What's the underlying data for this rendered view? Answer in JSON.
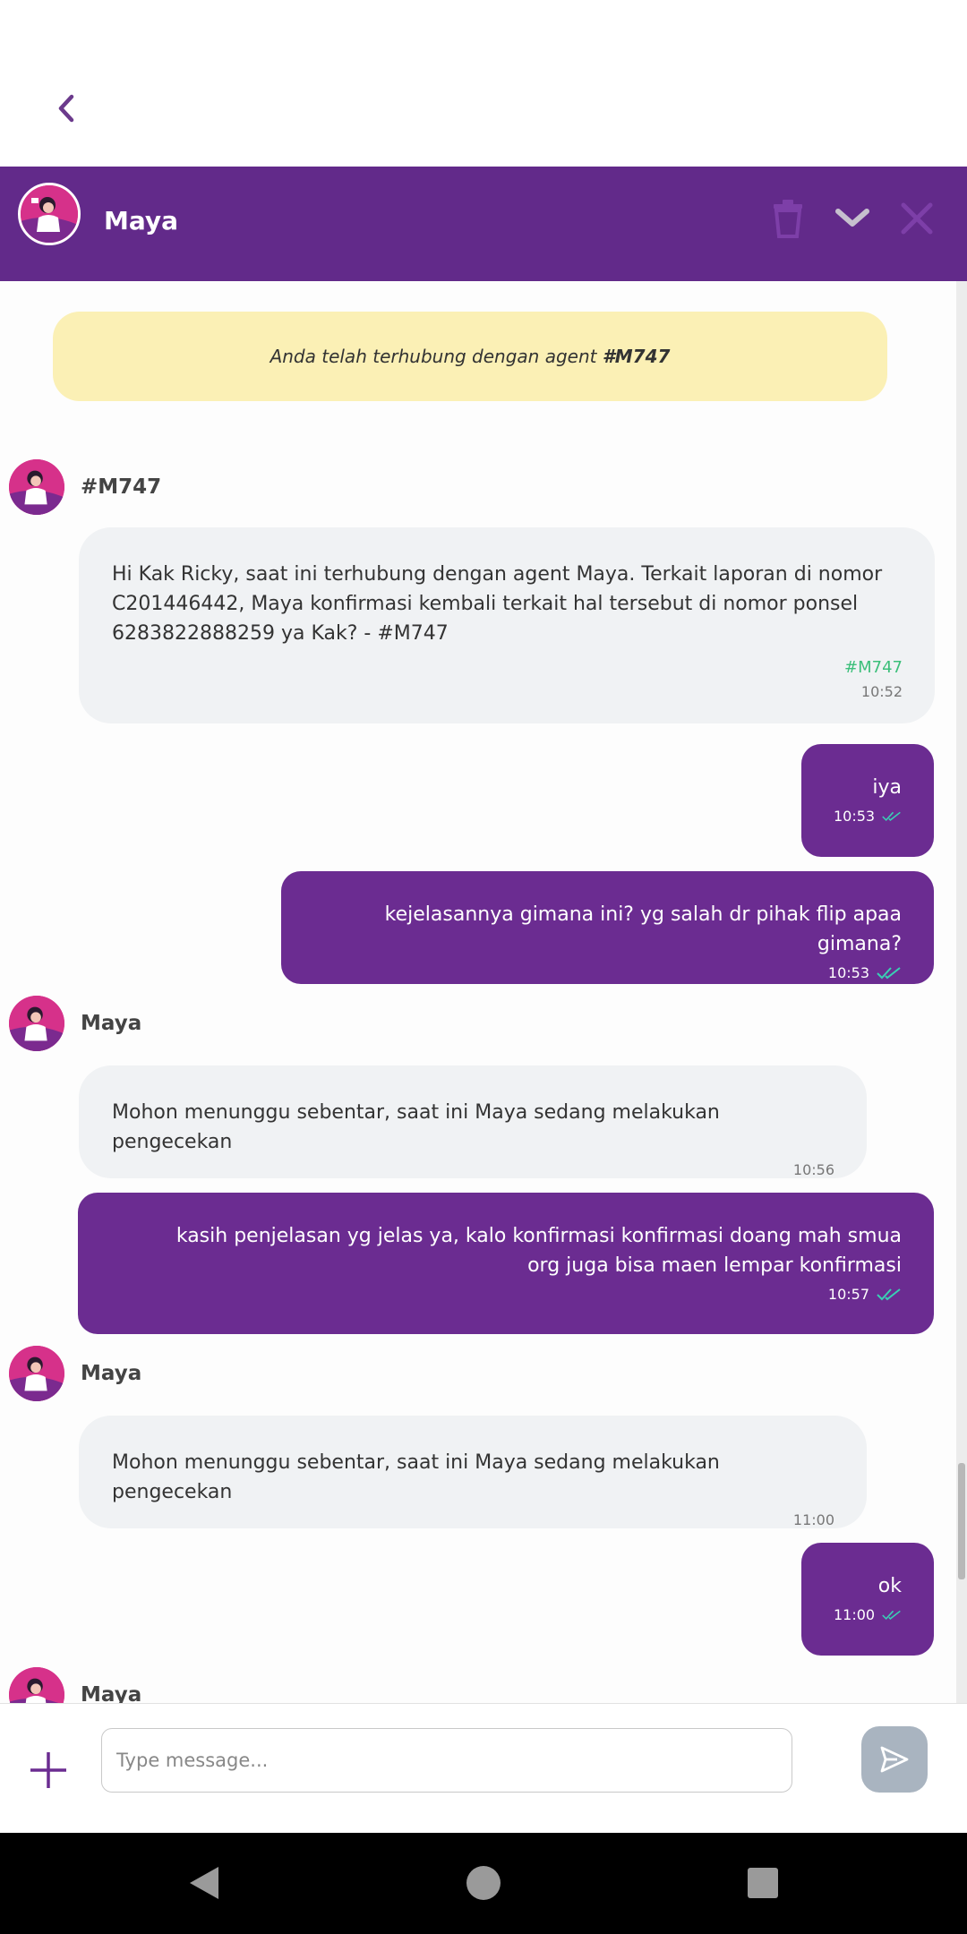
{
  "header": {
    "agent_name": "Maya",
    "icons": [
      "back-icon",
      "trash-icon",
      "chevron-down-icon",
      "close-icon"
    ]
  },
  "notice": {
    "text": "Anda telah terhubung dengan agent",
    "agent_code": "#M747"
  },
  "messages": [
    {
      "direction": "in",
      "sender": "#M747",
      "text": "Hi Kak Ricky, saat ini terhubung dengan agent Maya. Terkait laporan di nomor C201446442, Maya konfirmasi kembali terkait hal tersebut di nomor ponsel 6283822888259 ya Kak? - #M747",
      "agent_tag": "#M747",
      "time": "10:52"
    },
    {
      "direction": "out",
      "text": "iya",
      "time": "10:53",
      "status": "read"
    },
    {
      "direction": "out",
      "text": "kejelasannya gimana ini? yg salah dr pihak flip apaa gimana?",
      "time": "10:53",
      "status": "read"
    },
    {
      "direction": "in",
      "sender": "Maya",
      "text": "Mohon menunggu sebentar, saat ini Maya sedang melakukan pengecekan",
      "time": "10:56"
    },
    {
      "direction": "out",
      "text": "kasih penjelasan yg jelas ya, kalo konfirmasi konfirmasi doang mah smua org juga bisa maen lempar konfirmasi",
      "time": "10:57",
      "status": "read"
    },
    {
      "direction": "in",
      "sender": "Maya",
      "text": "Mohon menunggu sebentar, saat ini Maya sedang melakukan pengecekan",
      "time": "11:00"
    },
    {
      "direction": "out",
      "text": "ok",
      "time": "11:00",
      "status": "read"
    },
    {
      "direction": "in",
      "sender": "Maya"
    }
  ],
  "composer": {
    "placeholder": "Type message...",
    "value": ""
  },
  "colors": {
    "brand_purple": "#622a8a",
    "outgoing_bubble": "#6b2c91",
    "incoming_bubble": "#f0f2f4",
    "notice_bg": "#fbf0b5",
    "agent_tag": "#3cbf7a",
    "read_check": "#39d0b4"
  }
}
